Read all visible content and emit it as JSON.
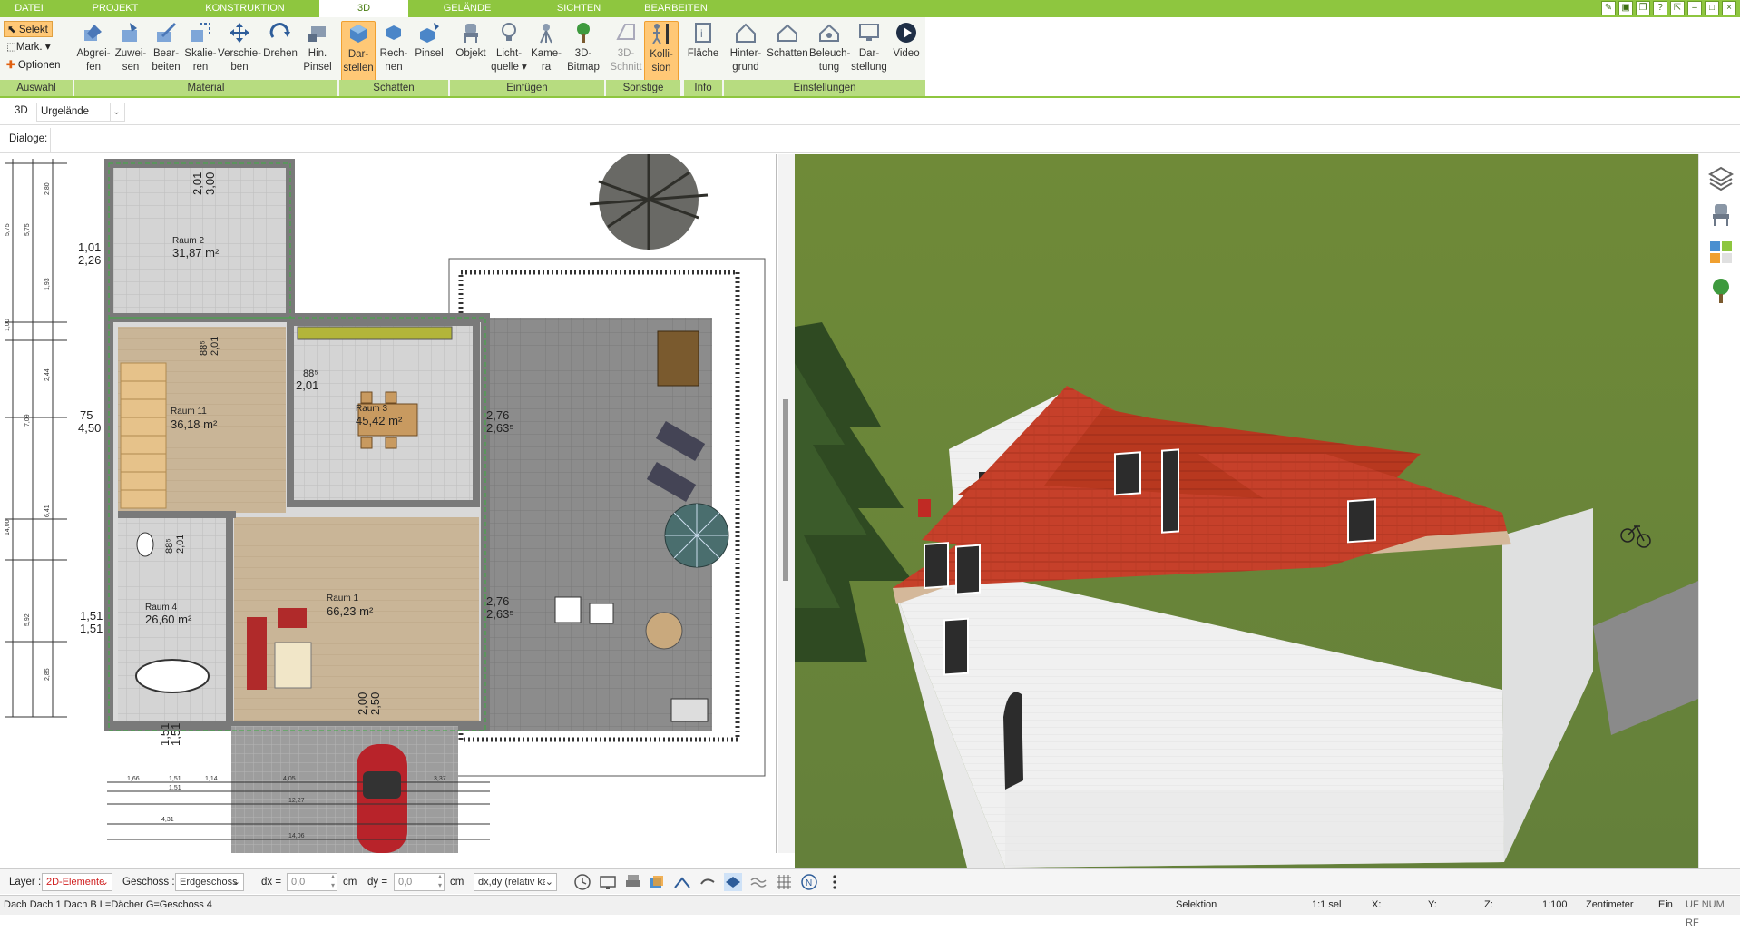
{
  "menu": {
    "tabs": [
      {
        "label": "DATEI"
      },
      {
        "label": "PROJEKT"
      },
      {
        "label": "KONSTRUKTION"
      },
      {
        "label": "3D"
      },
      {
        "label": "GELÄNDE"
      },
      {
        "label": "SICHTEN"
      },
      {
        "label": "BEARBEITEN"
      }
    ]
  },
  "ribbon": {
    "auswahl": {
      "selekt": "Selekt",
      "mark": "Mark.",
      "optionen": "Optionen",
      "group": "Auswahl"
    },
    "material": {
      "group": "Material",
      "buttons": [
        {
          "l1": "Abgrei-",
          "l2": "fen"
        },
        {
          "l1": "Zuwei-",
          "l2": "sen"
        },
        {
          "l1": "Bear-",
          "l2": "beiten"
        },
        {
          "l1": "Skalie-",
          "l2": "ren"
        },
        {
          "l1": "Verschie-",
          "l2": "ben"
        },
        {
          "l1": "Drehen",
          "l2": ""
        },
        {
          "l1": "Hin.",
          "l2": "Pinsel"
        }
      ]
    },
    "schatten": {
      "group": "Schatten",
      "buttons": [
        {
          "l1": "Dar-",
          "l2": "stellen"
        },
        {
          "l1": "Rech-",
          "l2": "nen"
        },
        {
          "l1": "Pinsel",
          "l2": ""
        }
      ]
    },
    "einfuegen": {
      "group": "Einfügen",
      "buttons": [
        {
          "l1": "Objekt",
          "l2": ""
        },
        {
          "l1": "Licht-",
          "l2": "quelle"
        },
        {
          "l1": "Kame-",
          "l2": "ra"
        },
        {
          "l1": "3D-",
          "l2": "Bitmap"
        }
      ]
    },
    "sonstige": {
      "group": "Sonstige",
      "buttons": [
        {
          "l1": "3D-",
          "l2": "Schnitt"
        },
        {
          "l1": "Kolli-",
          "l2": "sion"
        }
      ]
    },
    "info": {
      "group": "Info",
      "buttons": [
        {
          "l1": "Fläche",
          "l2": ""
        }
      ]
    },
    "einstellungen": {
      "group": "Einstellungen",
      "buttons": [
        {
          "l1": "Hinter-",
          "l2": "grund"
        },
        {
          "l1": "Schatten",
          "l2": ""
        },
        {
          "l1": "Beleuch-",
          "l2": "tung"
        },
        {
          "l1": "Dar-",
          "l2": "stellung"
        },
        {
          "l1": "Video",
          "l2": ""
        }
      ]
    }
  },
  "viewbar": {
    "mode": "3D",
    "layer_select": "Urgelände"
  },
  "dialogbar": {
    "label": "Dialoge:"
  },
  "plan": {
    "rooms": [
      {
        "name": "Raum 2",
        "area": "31,87 m²"
      },
      {
        "name": "Raum 11",
        "area": "36,18 m²"
      },
      {
        "name": "Raum 3",
        "area": "45,42 m²"
      },
      {
        "name": "Raum 4",
        "area": "26,60 m²"
      },
      {
        "name": "Raum 1",
        "area": "66,23 m²"
      }
    ],
    "dims": {
      "d1": "2,01",
      "d2": "3,00",
      "d3": "1,01",
      "d4": "2,26",
      "d5": "88⁵",
      "d6": "2,01",
      "d7": "88⁵",
      "d8": "2,01",
      "d9": "75",
      "d10": "4,50",
      "d11": "2,76",
      "d12": "2,63⁵",
      "d13": "88⁵",
      "d14": "2,01",
      "d15": "1,51",
      "d16": "1,51",
      "d17": "2,76",
      "d18": "2,63⁵",
      "d19": "2,00",
      "d20": "2,50",
      "d21": "1,51",
      "d22": "1,51"
    },
    "left_ruler": [
      "5,75",
      "2,80",
      "1,93",
      "1,00",
      "2,44",
      "7,09",
      "6,41",
      "14,00",
      "5,92",
      "2,85"
    ],
    "bottom_dims": [
      "1,66",
      "1,51",
      "1,14",
      "4,05",
      "3,37",
      "1,51",
      "12,27",
      "4,31",
      "14,06"
    ]
  },
  "bottom_toolbar": {
    "layer_label": "Layer :",
    "layer_value": "2D-Elemente",
    "geschoss_label": "Geschoss :",
    "geschoss_value": "Erdgeschoss",
    "dx_label": "dx =",
    "dx_value": "0,0",
    "dx_unit": "cm",
    "dy_label": "dy =",
    "dy_value": "0,0",
    "dy_unit": "cm",
    "mode_value": "dx,dy (relativ ka"
  },
  "status": {
    "info": "Dach Dach 1 Dach B L=Dächer G=Geschoss 4",
    "mode": "Selektion",
    "selection": "1:1 sel",
    "x": "X:",
    "y": "Y:",
    "z": "Z:",
    "scale": "1:100",
    "unit": "Zentimeter",
    "ein": "Ein",
    "flags": "UF NUM RF"
  },
  "colors": {
    "accent": "#8ec63f",
    "roof": "#c6402a",
    "wall": "#f2f2f2",
    "grass": "#6f8a38",
    "highlight": "#ffc876"
  }
}
